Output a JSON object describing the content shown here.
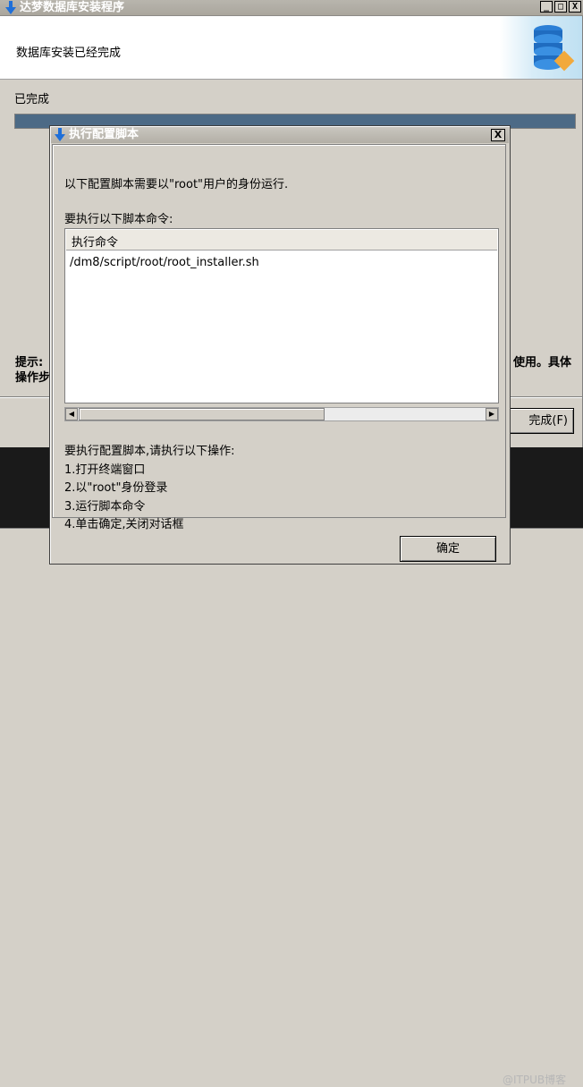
{
  "main_window": {
    "title": "达梦数据库安装程序",
    "header_text": "数据库安装已经完成",
    "status_text": "已完成",
    "progress": 1.0,
    "tip_left_line1": "提示:",
    "tip_left_line2": "操作步",
    "tip_right_line1": "使用。具体",
    "finish_button": "完成(F)",
    "min_glyph": "_",
    "max_glyph": "□",
    "close_glyph": "X"
  },
  "dialog": {
    "title": "执行配置脚本",
    "close_glyph": "X",
    "message": "以下配置脚本需要以\"root\"用户的身份运行.",
    "table_label": "要执行以下脚本命令:",
    "column_header": "执行命令",
    "rows": [
      "/dm8/script/root/root_installer.sh"
    ],
    "instructions_title": "要执行配置脚本,请执行以下操作:",
    "steps": [
      "1.打开终端窗口",
      "2.以\"root\"身份登录",
      "3.运行脚本命令",
      "4.单击确定,关闭对话框"
    ],
    "ok_button": "确定",
    "scroll_left_glyph": "◀",
    "scroll_right_glyph": "▶"
  },
  "watermark": "@ITPUB博客",
  "colors": {
    "progress": "#4c6a86",
    "title_icon": "#1e6fd9"
  },
  "icons": [
    "down-arrow-icon",
    "database-server-icon"
  ]
}
